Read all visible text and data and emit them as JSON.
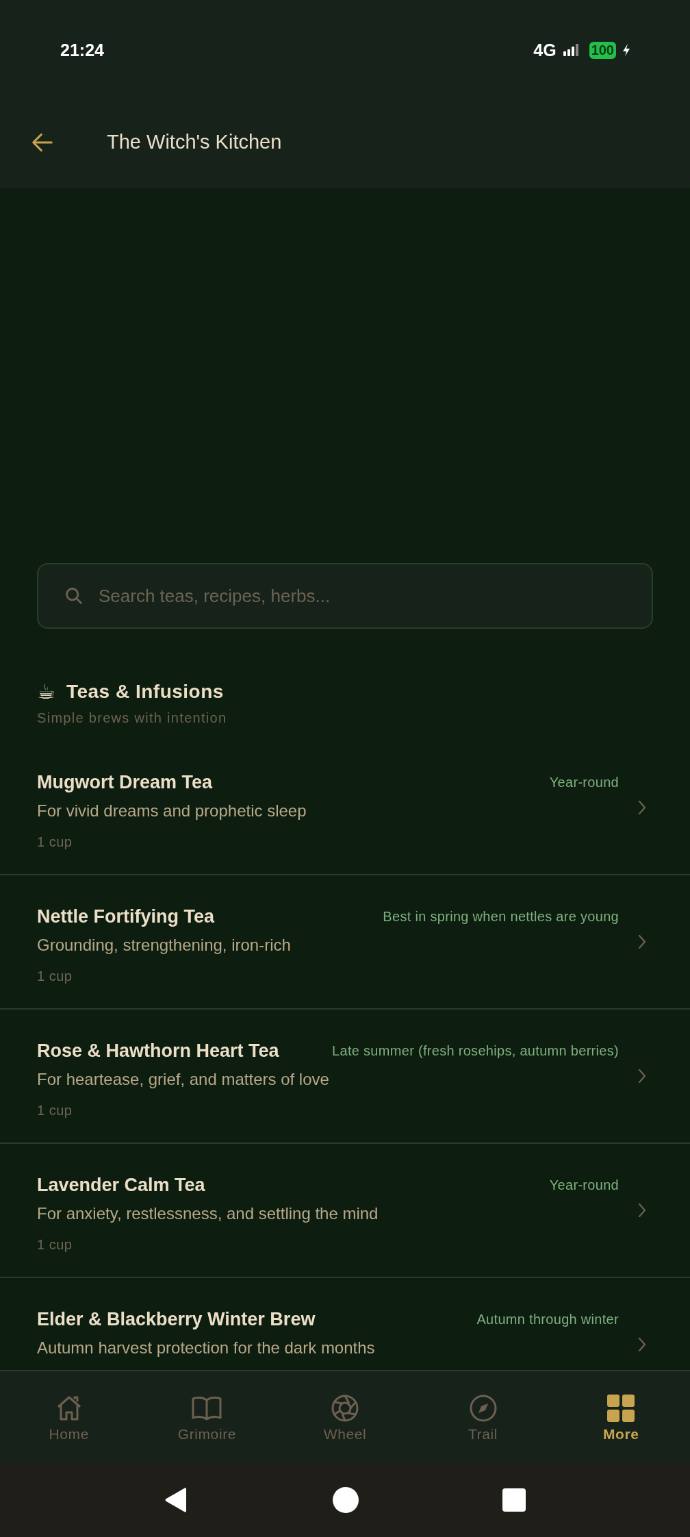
{
  "status_bar": {
    "time": "21:24",
    "network": "4G",
    "battery": "100"
  },
  "header": {
    "title": "The Witch's Kitchen"
  },
  "search": {
    "placeholder": "Search teas, recipes, herbs..."
  },
  "section": {
    "icon": "☕",
    "title": "Teas & Infusions",
    "subtitle": "Simple brews with intention"
  },
  "recipes": [
    {
      "title": "Mugwort Dream Tea",
      "season": "Year-round",
      "description": "For vivid dreams and prophetic sleep",
      "yield": "1 cup"
    },
    {
      "title": "Nettle Fortifying Tea",
      "season": "Best in spring when nettles are young",
      "description": "Grounding, strengthening, iron-rich",
      "yield": "1 cup"
    },
    {
      "title": "Rose & Hawthorn Heart Tea",
      "season": "Late summer (fresh rosehips, autumn berries)",
      "description": "For heartease, grief, and matters of love",
      "yield": "1 cup"
    },
    {
      "title": "Lavender Calm Tea",
      "season": "Year-round",
      "description": "For anxiety, restlessness, and settling the mind",
      "yield": "1 cup"
    },
    {
      "title": "Elder & Blackberry Winter Brew",
      "season": "Autumn through winter",
      "description": "Autumn harvest protection for the dark months"
    }
  ],
  "bottom_nav": [
    {
      "kind": "home",
      "label": "Home",
      "selected": false
    },
    {
      "kind": "book",
      "label": "Grimoire",
      "selected": false
    },
    {
      "kind": "wheel",
      "label": "Wheel",
      "selected": false
    },
    {
      "kind": "compass",
      "label": "Trail",
      "selected": false
    },
    {
      "kind": "grid",
      "label": "More",
      "selected": true
    }
  ]
}
